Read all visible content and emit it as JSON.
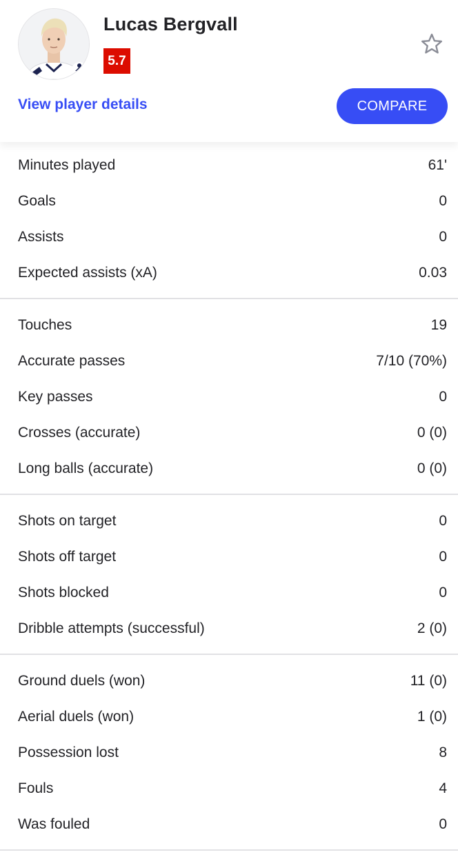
{
  "player": {
    "name": "Lucas Bergvall",
    "rating": "5.7"
  },
  "actions": {
    "details_label": "View player details",
    "compare_label": "COMPARE"
  },
  "colors": {
    "accent": "#374df5",
    "rating_bad": "#dc0c00",
    "divider": "#e1e1e4"
  },
  "groups": [
    {
      "rows": [
        {
          "label": "Minutes played",
          "value": "61'"
        },
        {
          "label": "Goals",
          "value": "0"
        },
        {
          "label": "Assists",
          "value": "0"
        },
        {
          "label": "Expected assists (xA)",
          "value": "0.03"
        }
      ]
    },
    {
      "rows": [
        {
          "label": "Touches",
          "value": "19"
        },
        {
          "label": "Accurate passes",
          "value": "7/10 (70%)"
        },
        {
          "label": "Key passes",
          "value": "0"
        },
        {
          "label": "Crosses (accurate)",
          "value": "0 (0)"
        },
        {
          "label": "Long balls (accurate)",
          "value": "0 (0)"
        }
      ]
    },
    {
      "rows": [
        {
          "label": "Shots on target",
          "value": "0"
        },
        {
          "label": "Shots off target",
          "value": "0"
        },
        {
          "label": "Shots blocked",
          "value": "0"
        },
        {
          "label": "Dribble attempts (successful)",
          "value": "2 (0)"
        }
      ]
    },
    {
      "rows": [
        {
          "label": "Ground duels (won)",
          "value": "11 (0)"
        },
        {
          "label": "Aerial duels (won)",
          "value": "1 (0)"
        },
        {
          "label": "Possession lost",
          "value": "8"
        },
        {
          "label": "Fouls",
          "value": "4"
        },
        {
          "label": "Was fouled",
          "value": "0"
        }
      ]
    }
  ]
}
